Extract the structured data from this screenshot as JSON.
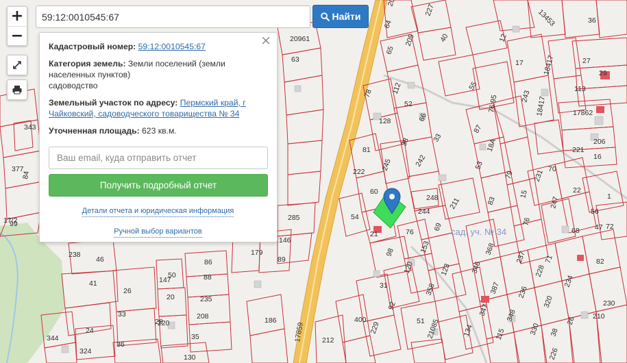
{
  "search": {
    "value": "59:12:0010545:67",
    "button_label": "Найти"
  },
  "controls": {
    "zoom_in": "+",
    "zoom_out": "−"
  },
  "popup": {
    "cadastral_label": "Кадастровый номер:",
    "cadastral_value": "59:12:0010545:67",
    "category_label": "Категория земель:",
    "category_value": "Земли поселений (земли населенных пунктов)",
    "category_use": "садоводство",
    "address_label": "Земельный участок по адресу:",
    "address_value": "Пермский край, г Чайковский, садоводческого товарищества № 34",
    "area_label": "Уточненная площадь:",
    "area_value": "623 кв.м.",
    "email_placeholder": "Ваш email, куда отправить отчет",
    "report_button": "Получить подробный отчет",
    "details_link": "Детали отчета и юридическая информация",
    "manual_link": "Ручной выбор вариантов"
  },
  "map": {
    "colors": {
      "background": "#f2f0ec",
      "parcel_line": "#c8323c",
      "road": "#f2c25a",
      "highlight": "#3fdc5a",
      "marker": "#2e79c5",
      "building": "#d4d4d4",
      "forest": "#cfe3bf"
    },
    "area_label": "сад. уч. № 34",
    "road_label": "17859",
    "parcel_labels": [
      "204",
      "227",
      "13453",
      "36",
      "64",
      "205",
      "40",
      "12",
      "65",
      "20961",
      "63",
      "17",
      "27",
      "18417",
      "29",
      "113",
      "112",
      "55",
      "78",
      "52",
      "76:95",
      "243",
      "18417",
      "17862",
      "128",
      "66",
      "87",
      "206",
      "221",
      "16",
      "38",
      "33",
      "18А",
      "81",
      "245",
      "242",
      "53",
      "79",
      "231",
      "70",
      "222",
      "60",
      "248",
      "15",
      "22",
      "1",
      "247",
      "83",
      "56",
      "54",
      "244",
      "211",
      "47",
      "21",
      "76",
      "69",
      "76",
      "68",
      "72",
      "238",
      "46",
      "86",
      "50",
      "147",
      "88",
      "179",
      "89",
      "285",
      "146",
      "153",
      "98",
      "368",
      "237",
      "71",
      "82",
      "41",
      "26",
      "20",
      "235",
      "120",
      "123",
      "346",
      "387",
      "236",
      "228",
      "234",
      "230",
      "33",
      "28",
      "208",
      "31",
      "358",
      "347",
      "348",
      "320",
      "210",
      "24",
      "220",
      "36",
      "35",
      "400",
      "92",
      "51",
      "134",
      "115",
      "330",
      "38",
      "26",
      "226",
      "212",
      "229",
      "21085",
      "344",
      "324",
      "130",
      "186",
      "17/2",
      "343",
      "377",
      "84",
      "99",
      "384",
      "382",
      "11"
    ]
  }
}
